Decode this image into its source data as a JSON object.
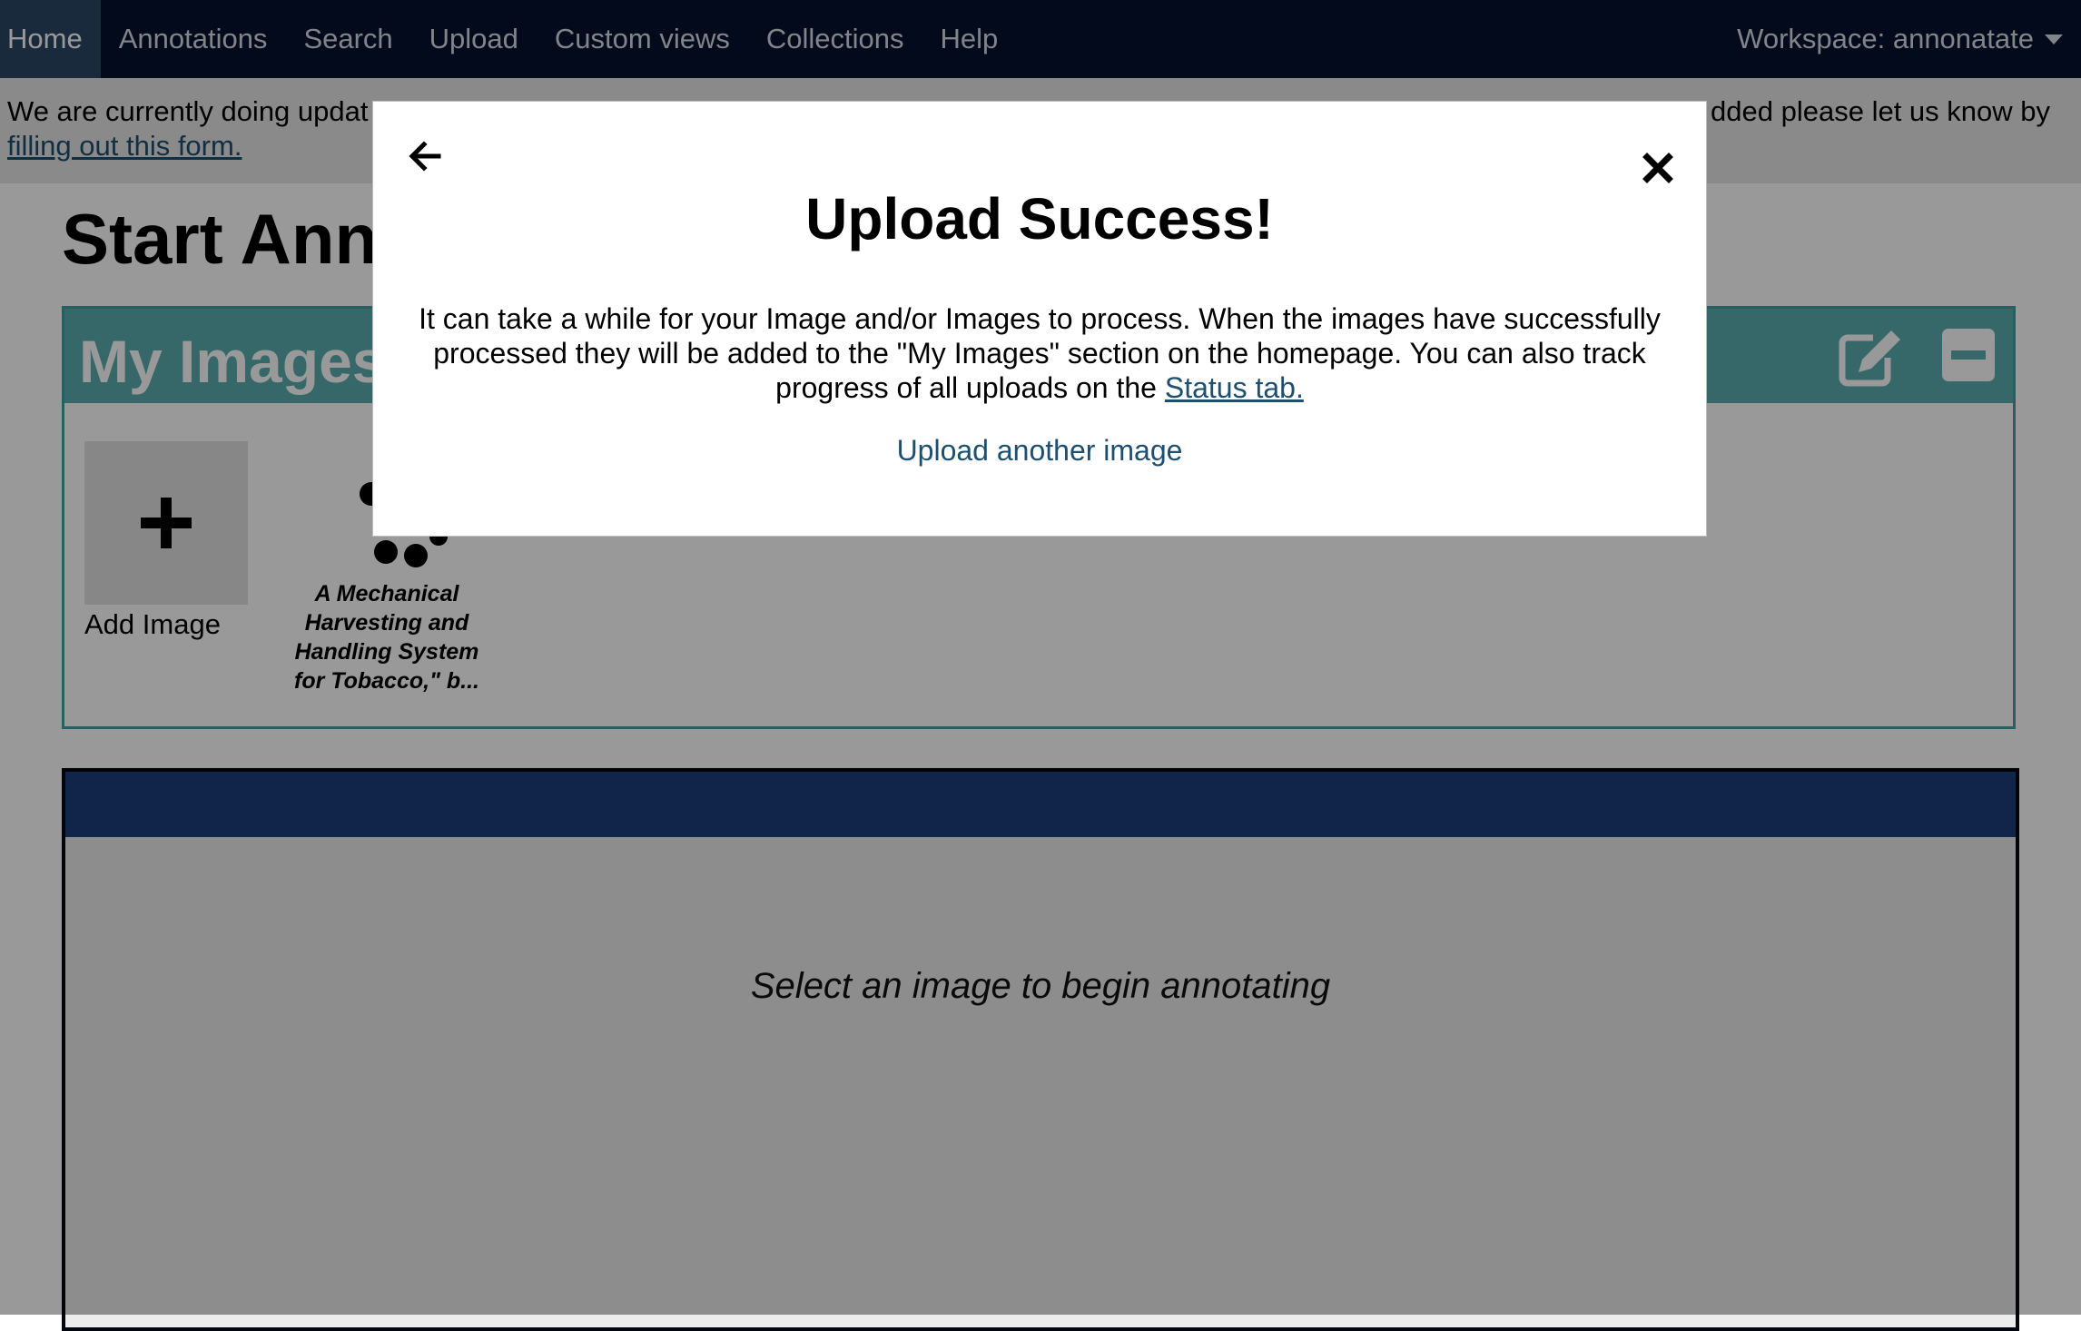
{
  "nav": {
    "items": [
      {
        "label": "Home",
        "active": true
      },
      {
        "label": "Annotations"
      },
      {
        "label": "Search"
      },
      {
        "label": "Upload"
      },
      {
        "label": "Custom views"
      },
      {
        "label": "Collections"
      },
      {
        "label": "Help"
      }
    ],
    "workspace": "Workspace: annonatate"
  },
  "notice": {
    "text_left": "We are currently doing updat",
    "text_right": "dded please let us know by",
    "link": "filling out this form."
  },
  "page": {
    "title": "Start Ann"
  },
  "my_images": {
    "title": "My Images",
    "add_label": "Add Image",
    "thumbnail_caption": "A Mechanical Harvesting and Handling System for Tobacco,\" b..."
  },
  "viewer": {
    "placeholder": "Select an image to begin annotating"
  },
  "modal": {
    "title": "Upload Success!",
    "body": "It can take a while for your Image and/or Images to process. When the images have successfully processed they will be added to the \"My Images\" section on the homepage. You can also track progress of all uploads on the",
    "status_link": "Status tab.",
    "action": "Upload another image"
  },
  "colors": {
    "navbar": "#06122e",
    "nav_active": "#2c4767",
    "teal_header": "#5aaeb1",
    "link": "#1d4f71",
    "viewer_header": "#1b3f7a"
  },
  "icons": [
    "arrow-left-icon",
    "close-icon",
    "edit-icon",
    "minimize-icon",
    "plus-icon",
    "loading-spinner-icon",
    "caret-down-icon"
  ]
}
